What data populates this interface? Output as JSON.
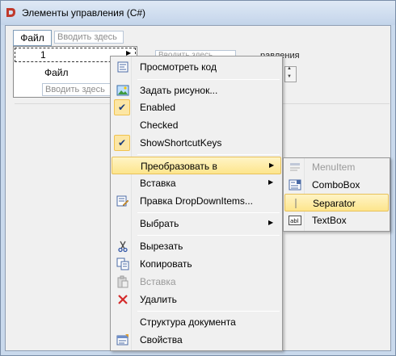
{
  "window": {
    "title": "Элементы управления (C#)"
  },
  "form": {
    "menu_top": {
      "file": "Файл",
      "placeholder": "Вводить здесь"
    },
    "dropdown": {
      "item_1": "1",
      "file": "Файл",
      "placeholder": "Вводить здесь"
    },
    "background": {
      "text_input": "Вводить здесь",
      "label": "равления"
    }
  },
  "context_menu": {
    "items": [
      {
        "label": "Просмотреть код",
        "icon": "view-code-icon"
      },
      {
        "label": "Задать рисунок...",
        "icon": "image-icon"
      },
      {
        "label": "Enabled",
        "checked": true
      },
      {
        "label": "Checked",
        "checked": false
      },
      {
        "label": "ShowShortcutKeys",
        "checked": true
      },
      {
        "label": "Преобразовать в",
        "submenu": true,
        "highlighted": true
      },
      {
        "label": "Вставка",
        "submenu": true
      },
      {
        "label": "Правка DropDownItems...",
        "icon": "edit-items-icon"
      },
      {
        "label": "Выбрать",
        "submenu": true
      },
      {
        "label": "Вырезать",
        "icon": "scissors-icon"
      },
      {
        "label": "Копировать",
        "icon": "copy-icon"
      },
      {
        "label": "Вставка",
        "icon": "paste-icon",
        "disabled": true
      },
      {
        "label": "Удалить",
        "icon": "delete-icon"
      },
      {
        "label": "Структура документа"
      },
      {
        "label": "Свойства",
        "icon": "properties-icon"
      }
    ]
  },
  "submenu": {
    "items": [
      {
        "label": "MenuItem",
        "icon": "menuitem-icon",
        "disabled": true
      },
      {
        "label": "ComboBox",
        "icon": "combobox-icon"
      },
      {
        "label": "Separator",
        "icon": "separator-icon",
        "highlighted": true
      },
      {
        "label": "TextBox",
        "icon": "textbox-icon"
      }
    ]
  },
  "colors": {
    "highlight": "#fde58c",
    "check_bg": "#fce6a4",
    "title_bg": "#c9d9ec"
  }
}
